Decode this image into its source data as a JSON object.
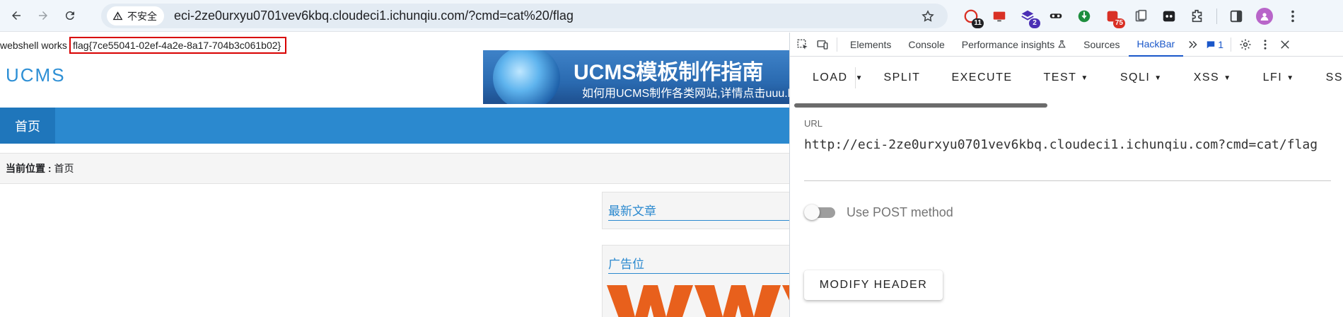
{
  "browser": {
    "security_label": "不安全",
    "url": "eci-2ze0urxyu0701vev6kbq.cloudeci1.ichunqiu.com/?cmd=cat%20/flag",
    "extensions": [
      {
        "name": "extension-a-icon",
        "badge": "11",
        "badge_color": "#202124"
      },
      {
        "name": "extension-b-icon",
        "badge": "",
        "badge_color": ""
      },
      {
        "name": "extension-c-icon",
        "badge": "2",
        "badge_color": "#4b2fb5"
      },
      {
        "name": "extension-d-icon",
        "badge": "",
        "badge_color": ""
      },
      {
        "name": "extension-e-icon",
        "badge": "",
        "badge_color": ""
      },
      {
        "name": "extension-f-icon",
        "badge": "75",
        "badge_color": "#d93025"
      },
      {
        "name": "extension-g-icon",
        "badge": "",
        "badge_color": ""
      },
      {
        "name": "extension-h-icon",
        "badge": "",
        "badge_color": ""
      }
    ]
  },
  "page": {
    "webshell_text": "webshell works",
    "flag_text": "flag{7ce55041-02ef-4a2e-8a17-704b3c061b02}",
    "logo": "UCMS",
    "banner_title": "UCMS模板制作指南",
    "banner_subtitle": "如何用UCMS制作各类网站,详情点击uuu.la",
    "nav_home": "首页",
    "breadcrumb_label": "当前位置 :",
    "breadcrumb_value": "首页",
    "latest_title": "最新文章",
    "ads_title": "广告位"
  },
  "devtools": {
    "tabs": [
      "Elements",
      "Console",
      "Performance insights",
      "Sources",
      "HackBar"
    ],
    "active_tab": "HackBar",
    "issues_count": "1",
    "hackbar": {
      "menu": {
        "load": "LOAD",
        "split": "SPLIT",
        "execute": "EXECUTE",
        "test": "TEST",
        "sqli": "SQLI",
        "xss": "XSS",
        "lfi": "LFI",
        "ssti": "SSTI"
      },
      "url_label": "URL",
      "url_value": "http://eci-2ze0urxyu0701vev6kbq.cloudeci1.ichunqiu.com?cmd=cat/flag",
      "post_label": "Use POST method",
      "post_enabled": false,
      "modify_header": "MODIFY HEADER"
    }
  },
  "colors": {
    "accent_blue": "#2b89cf",
    "flag_border": "#d80000",
    "devtools_active": "#1a57c9"
  }
}
